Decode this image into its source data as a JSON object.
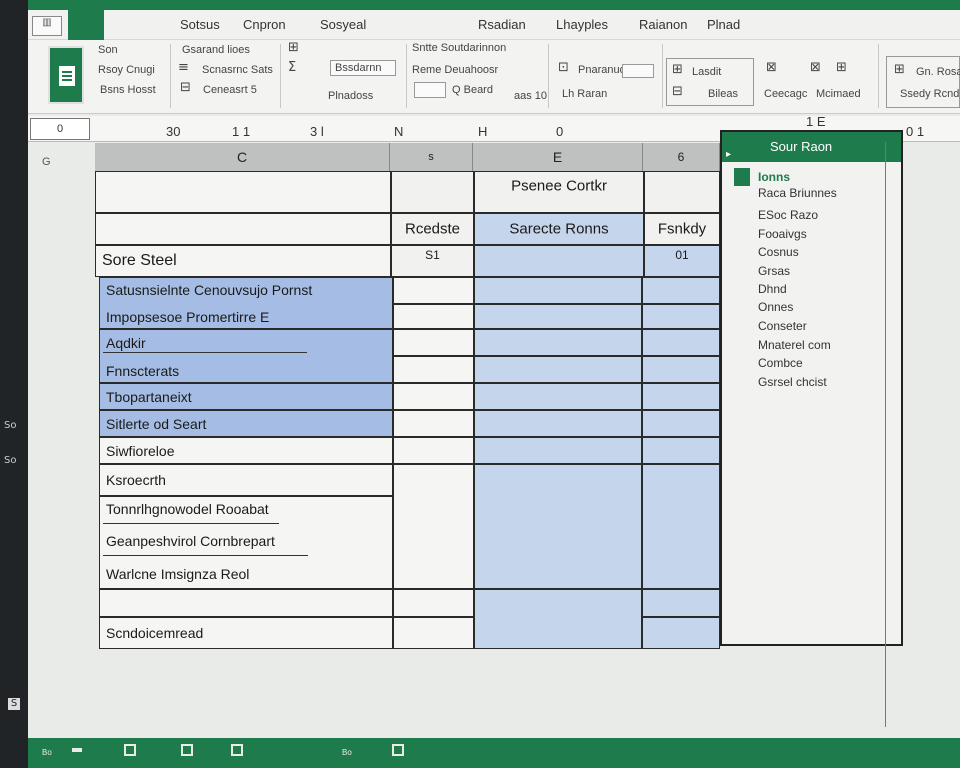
{
  "window": {
    "tabs": [
      "Sotsus",
      "Cnpron",
      "Sosyeal",
      "Rsadian",
      "Lhayples",
      "Raianon",
      "Plnad"
    ],
    "tab_doc_label": "▥"
  },
  "ribbon": {
    "group1": {
      "top_label": "Son",
      "label_a": "Rsoy Cnugi",
      "label_b": "Bsns Hosst"
    },
    "group2": {
      "top_label": "Gsarand lioes",
      "label_a": "Scnasrnc Sats",
      "label_b": "Ceneasrt 5"
    },
    "group3": {
      "box_label": "Bssdarnn",
      "label_a": "Plnadoss"
    },
    "group4": {
      "top_label": "Sntte Soutdarinnon",
      "label_a": "Reme Deuahoosr",
      "label_b": "Q Beard",
      "label_c": "aas 10"
    },
    "group5": {
      "label_a": "Pnaranud",
      "label_b": "Lh Raran"
    },
    "group6": {
      "label_a": "Lasdit",
      "label_b": "Bileas"
    },
    "group7": {
      "label_a": "Ceecagc",
      "label_b": "Mcimaed"
    },
    "group8": {
      "label_a": "Gn. Rosa",
      "label_b": "Ssedy Rcnd"
    }
  },
  "formula_bar": {
    "name_box": "0",
    "values": [
      "30",
      "1 1",
      "3 l",
      "N",
      "H",
      "0",
      "1 E",
      "0 1"
    ]
  },
  "columns": [
    "C",
    "s",
    "E",
    "6"
  ],
  "row_numbers": [
    "G"
  ],
  "sheet": {
    "header_title": "Psenee Cortkr",
    "col_headers": [
      "Rcedste",
      "Sarecte Ronns",
      "Fsnkdy"
    ],
    "first_row": {
      "label": "Sore Steel",
      "v1": "S1",
      "v2": "",
      "v3": "01"
    },
    "rows": [
      "Satusnsielnte Cenouvsujo Pornst",
      "Impopsesoe Promertirre E",
      "Aqdkir",
      "Fnnscterats",
      "Tbopartaneixt",
      "Sitlerte od Seart",
      "Siwfioreloe",
      "Ksroecrth",
      "Tonnrlhgnowodel Rooabat",
      "Geanpeshvirol Cornbrepart",
      "Warlcne Imsignza Reol",
      "",
      "Scndoicemread"
    ]
  },
  "side_panel": {
    "title": "Sour Raon",
    "items": [
      "Ionns",
      "Raca Briunnes",
      "ESoc Razo",
      "Fooaivgs",
      "Cosnus",
      "Grsas",
      "Dhnd",
      "Onnes",
      "Conseter",
      "Mnaterel com",
      "Combce",
      "Gsrsel chcist"
    ]
  },
  "status_bar": {
    "left_text": "Bo",
    "mid_text": "Bo"
  },
  "bezel": {
    "marks": [
      "So",
      "So",
      "S",
      "S"
    ]
  }
}
